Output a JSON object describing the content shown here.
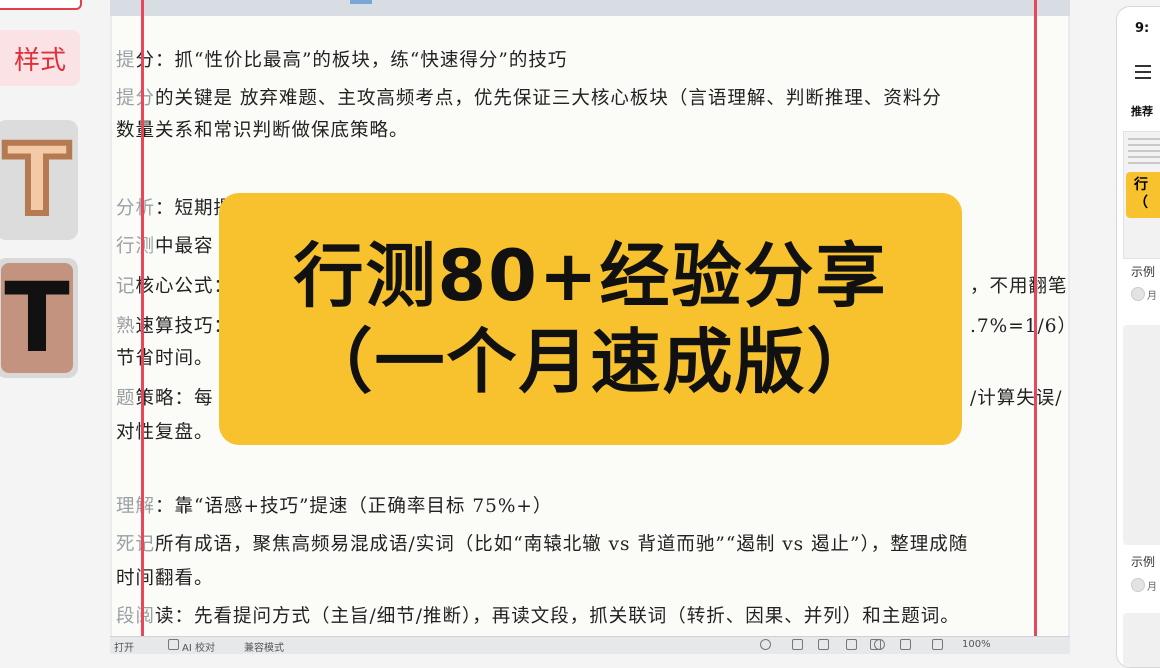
{
  "left_panel": {
    "style_tab_label": "样式",
    "tiles": [
      {
        "glyph": "T",
        "variant": "outlined-peach"
      },
      {
        "glyph": "T",
        "variant": "solid-black-on-brown"
      }
    ]
  },
  "document": {
    "lines": [
      {
        "faint": "提",
        "text": "分：抓“性价比最高”的板块，练“快速得分”的技巧"
      },
      {
        "faint": "提分",
        "text": "的关键是 放弃难题、主攻高频考点，优先保证三大核心板块（言语理解、判断推理、资料分"
      },
      {
        "faint": "",
        "text": "    数量关系和常识判断做保底策略。"
      },
      {
        "faint": "分析",
        "text": "：短期提"
      },
      {
        "faint": "行测",
        "text": "中最容"
      },
      {
        "faint": "记",
        "text": "核心公式：",
        "right": "，不用翻笔"
      },
      {
        "faint": "熟",
        "text": "速算技巧：",
        "right": ".7%=1/6），"
      },
      {
        "faint": "",
        "text": "节省时间。"
      },
      {
        "faint": "题",
        "text": "策略：每",
        "right": "/计算失误/"
      },
      {
        "faint": "",
        "text": "对性复盘。"
      },
      {
        "faint": "理解",
        "text": "：靠“语感+技巧”提速（正确率目标 75%+）"
      },
      {
        "faint": "死记",
        "text": "所有成语，聚焦高频易混成语/实词（比如“南辕北辙 vs 背道而驰”“遏制 vs 遏止”），整理成随"
      },
      {
        "faint": "",
        "text": "时间翻看。"
      },
      {
        "faint": "段阅",
        "text": "读：先看提问方式（主旨/细节/推断），再读文段，抓关联词（转折、因果、并列）和主题词。"
      }
    ]
  },
  "banner": {
    "line1": "行测80+经验分享",
    "line2": "（一个月速成版）",
    "color": "#f8c22f"
  },
  "statusbar": {
    "open_label": "打开",
    "ai_check_label": "AI 校对",
    "compat_mode_label": "兼容模式",
    "zoom_label": "100%"
  },
  "phone": {
    "time": "9:",
    "tab_label": "推荐",
    "thumb_banner_text_1": "行",
    "thumb_banner_text_2": "（",
    "caption_1": "示例",
    "author_1": "月",
    "caption_2": "示例",
    "author_2": "月"
  },
  "colors": {
    "accent_red": "#e8465a",
    "banner_yellow": "#f8c22f",
    "style_tab_bg": "#fbe3e5"
  }
}
